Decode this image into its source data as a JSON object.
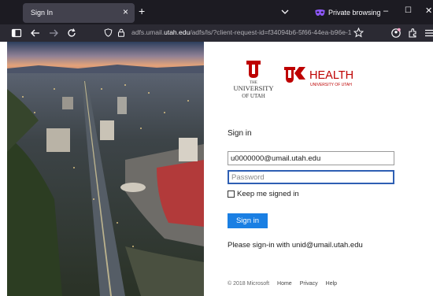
{
  "browser": {
    "tab_title": "Sign In",
    "tab_close_glyph": "×",
    "new_tab_glyph": "+",
    "private_label": "Private browsing",
    "minimize_glyph": "–",
    "maximize_glyph": "☐",
    "close_glyph": "✕",
    "url_prefix": "adfs.umail.",
    "url_domain": "utah.edu",
    "url_rest": "/adfs/ls/?client-request-id=f34094b6-5f66-44ea-b96e-1",
    "accent_private": "#9059ff"
  },
  "logos": {
    "uofu_the": "THE",
    "uofu_university": "UNIVERSITY",
    "uofu_of_utah": "OF UTAH",
    "health_word": "HEALTH",
    "health_sub": "UNIVERSITY OF UTAH",
    "brand_red": "#be0000"
  },
  "form": {
    "heading": "Sign in",
    "email_value": "u0000000@umail.utah.edu",
    "password_placeholder": "Password",
    "keep_signed_in": "Keep me signed in",
    "signin_button": "Sign in",
    "help_text": "Please sign-in with unid@umail.utah.edu",
    "button_color": "#1a7fe3"
  },
  "footer": {
    "copyright": "© 2018 Microsoft",
    "home": "Home",
    "privacy": "Privacy",
    "help": "Help"
  }
}
